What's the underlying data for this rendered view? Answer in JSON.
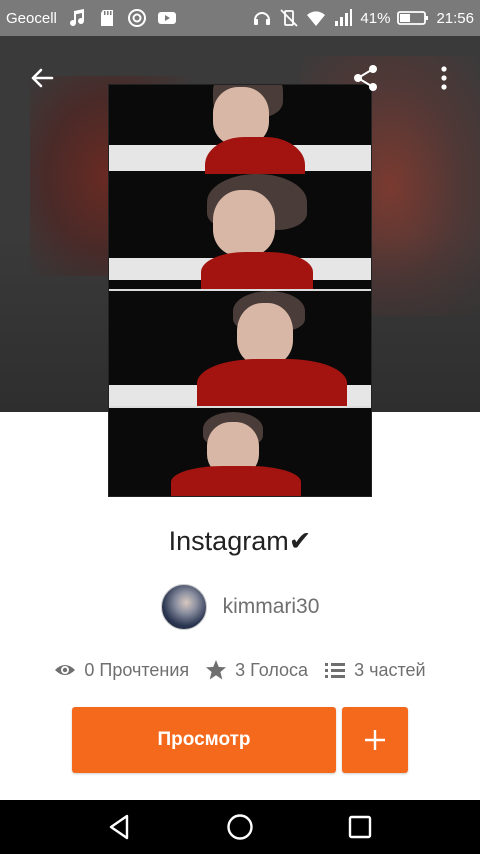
{
  "status_bar": {
    "carrier": "Geocell",
    "battery_percent": "41%",
    "time": "21:56",
    "icons_left": [
      "music-icon",
      "sd-card-icon",
      "wattpad-icon",
      "youtube-icon"
    ],
    "icons_right": [
      "headset-icon",
      "vibrate-icon",
      "wifi-icon",
      "signal-icon",
      "battery-icon"
    ]
  },
  "toolbar": {
    "back_icon": "arrow-left-icon",
    "share_icon": "share-icon",
    "more_icon": "more-vertical-icon"
  },
  "story": {
    "title": "Instagram✔",
    "author": "kimmari30",
    "reads": "0 Прочтения",
    "votes": "3 Голоса",
    "parts": "3 частей"
  },
  "actions": {
    "read_label": "Просмотр",
    "add_icon": "plus-icon"
  },
  "nav_bar": {
    "back_icon": "triangle-back-icon",
    "home_icon": "circle-home-icon",
    "recents_icon": "square-recents-icon"
  },
  "colors": {
    "accent": "#f5691c",
    "status_bar": "#7a7a7a",
    "text_primary": "#222222",
    "text_secondary": "#6f6f6f"
  }
}
